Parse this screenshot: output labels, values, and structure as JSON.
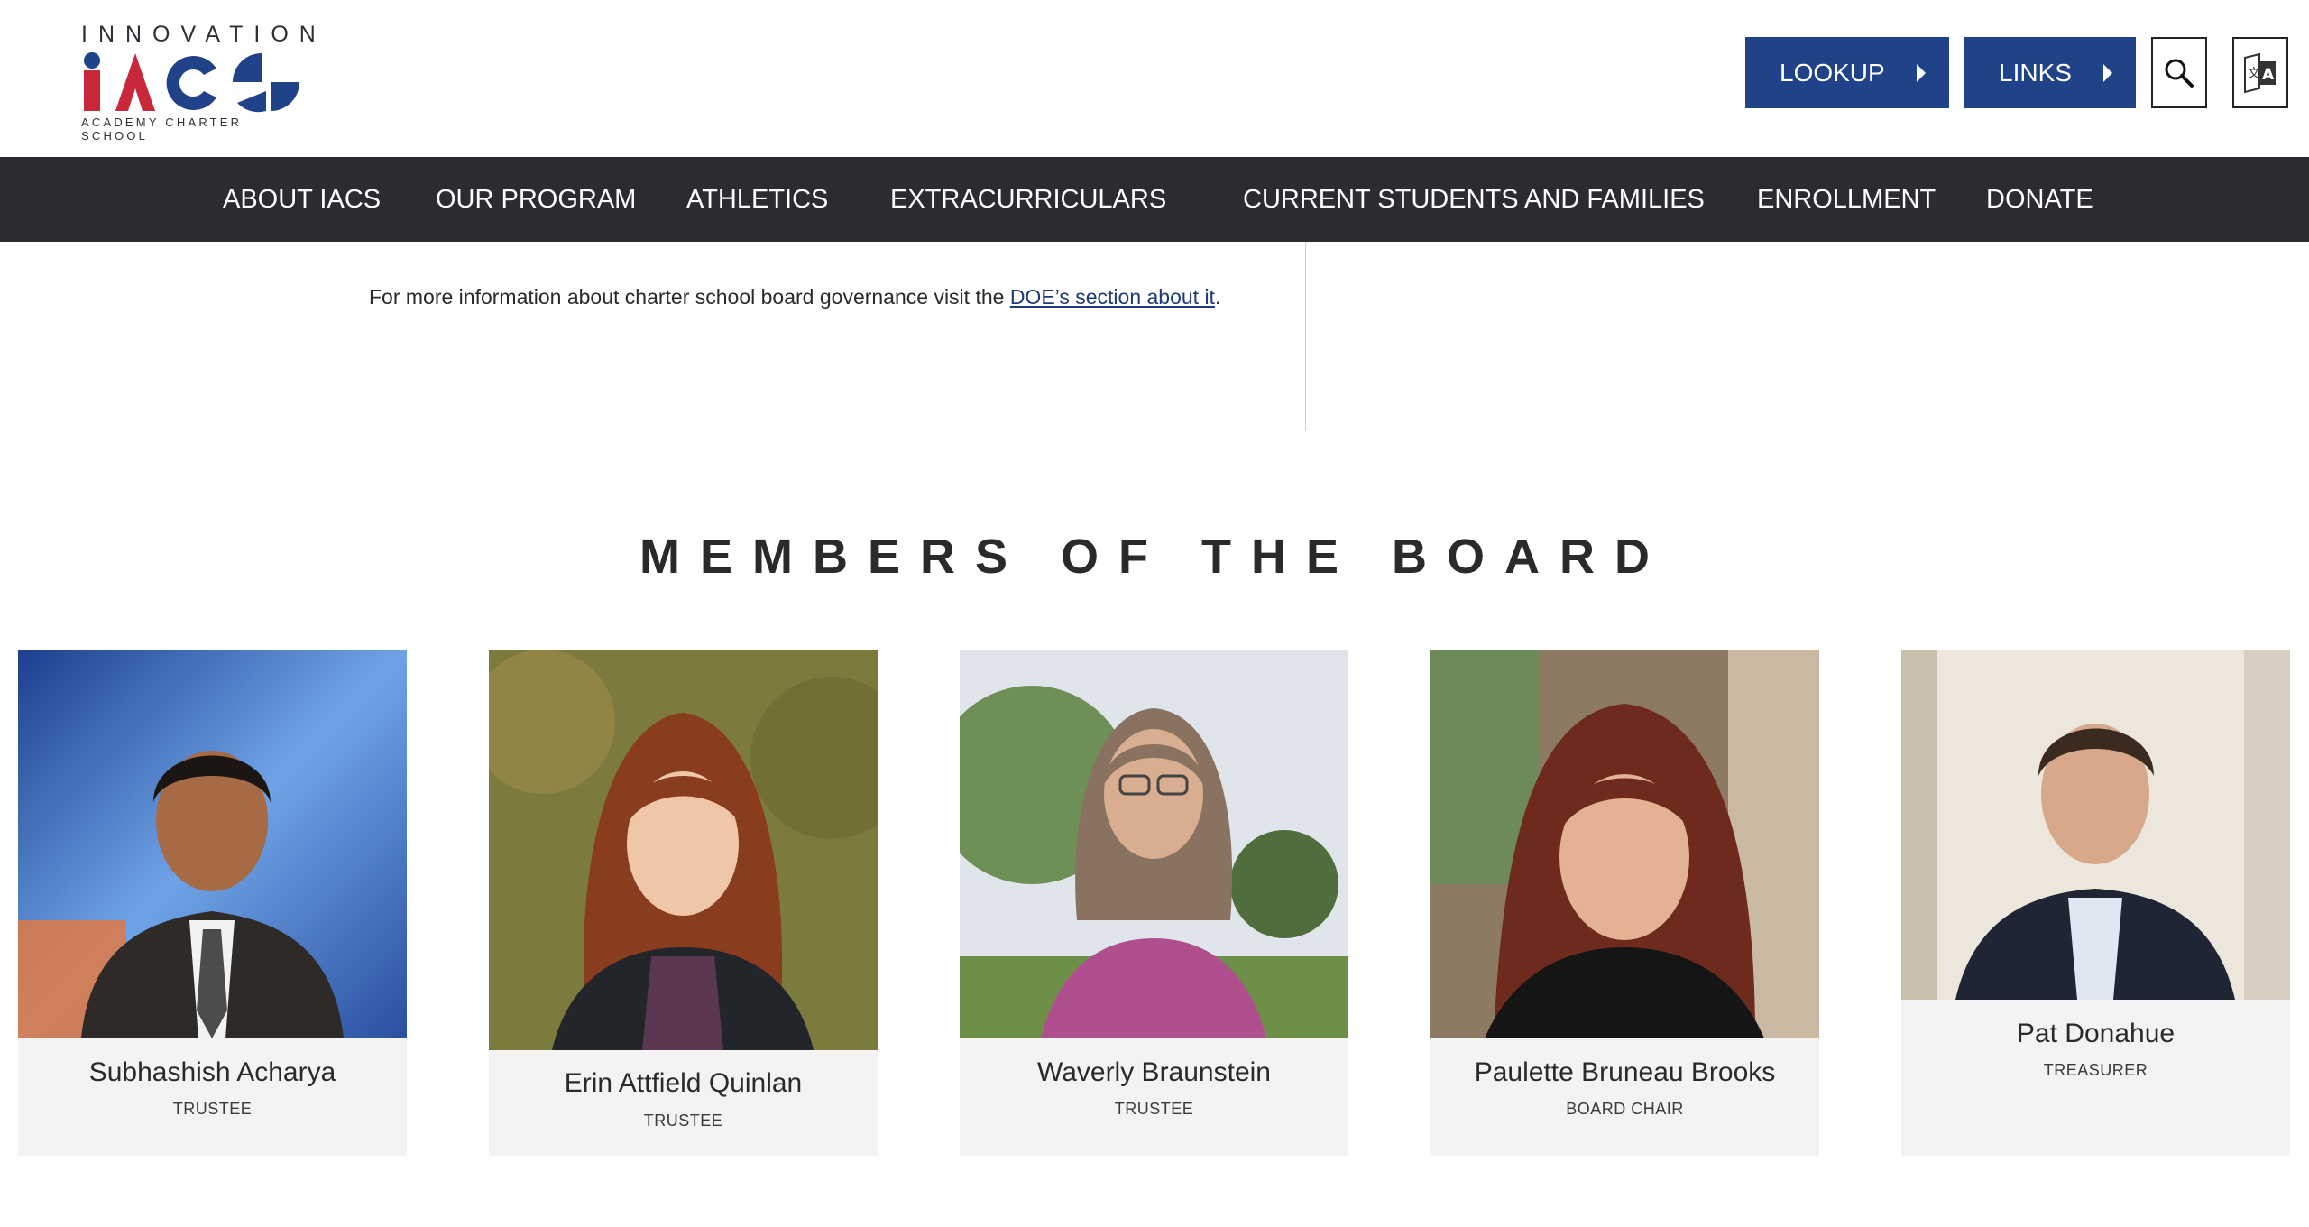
{
  "logo": {
    "top_text": "INNOVATION",
    "mark_text": "iACS",
    "bottom_text": "ACADEMY CHARTER SCHOOL",
    "colors": {
      "red": "#c8283a",
      "blue": "#1f4289"
    }
  },
  "header": {
    "lookup_label": "LOOKUP",
    "links_label": "LINKS",
    "search_icon": "search-icon",
    "translate_icon": "translate-icon",
    "button_color": "#1f4289"
  },
  "nav": {
    "items": [
      {
        "label": "ABOUT IACS"
      },
      {
        "label": "OUR PROGRAM"
      },
      {
        "label": "ATHLETICS"
      },
      {
        "label": "EXTRACURRICULARS"
      },
      {
        "label": "CURRENT STUDENTS AND FAMILIES"
      },
      {
        "label": "ENROLLMENT"
      },
      {
        "label": "DONATE"
      }
    ],
    "background": "#2b2b31"
  },
  "content": {
    "info_prefix": "For more information about charter school board governance visit the ",
    "info_link": "DOE’s section about it",
    "info_suffix": "."
  },
  "board": {
    "title": "MEMBERS OF THE BOARD",
    "members": [
      {
        "name": "Subhashish Acharya",
        "role": "TRUSTEE"
      },
      {
        "name": "Erin Attfield Quinlan",
        "role": "TRUSTEE"
      },
      {
        "name": "Waverly Braunstein",
        "role": "TRUSTEE"
      },
      {
        "name": "Paulette Bruneau Brooks",
        "role": "BOARD CHAIR"
      },
      {
        "name": "Pat Donahue",
        "role": "TREASURER"
      }
    ]
  }
}
